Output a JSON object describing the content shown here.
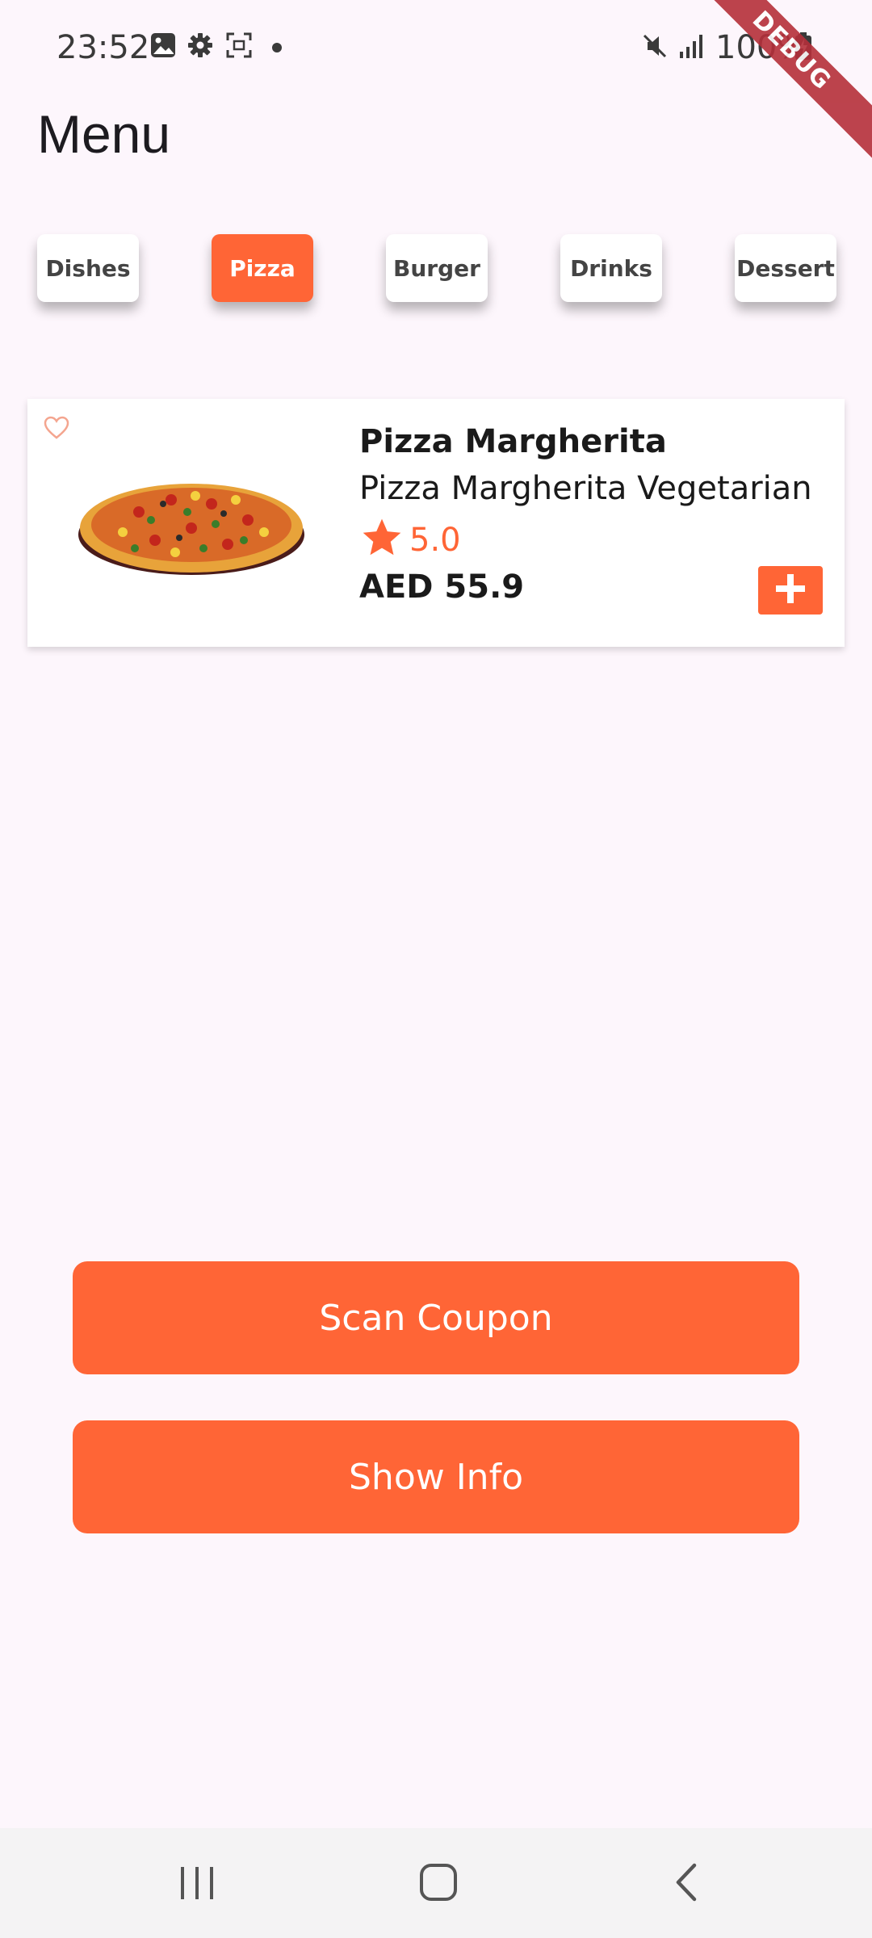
{
  "status_bar": {
    "time": "23:52",
    "battery": "100%",
    "icons": [
      "image-icon",
      "gear-icon",
      "screenshot-icon",
      "dot-icon",
      "mute-icon",
      "signal-icon",
      "battery-icon"
    ]
  },
  "debug_banner": "DEBUG",
  "header": {
    "title": "Menu"
  },
  "categories": [
    {
      "label": "Dishes",
      "active": false
    },
    {
      "label": "Pizza",
      "active": true
    },
    {
      "label": "Burger",
      "active": false
    },
    {
      "label": "Drinks",
      "active": false
    },
    {
      "label": "Dessert",
      "active": false
    }
  ],
  "product": {
    "name": "Pizza Margherita",
    "description": "Pizza Margherita Vegetarian",
    "rating": "5.0",
    "price": "AED 55.9",
    "favorite_icon": "heart-outline-icon",
    "add_icon": "plus-icon"
  },
  "actions": {
    "scan_coupon": "Scan Coupon",
    "show_info": "Show Info"
  },
  "nav_bar": {
    "icons": [
      "recent-apps-icon",
      "home-icon",
      "back-icon"
    ]
  },
  "colors": {
    "accent": "#ff6536",
    "background": "#fdf6fc",
    "card": "#ffffff",
    "debug": "#b5303a"
  }
}
